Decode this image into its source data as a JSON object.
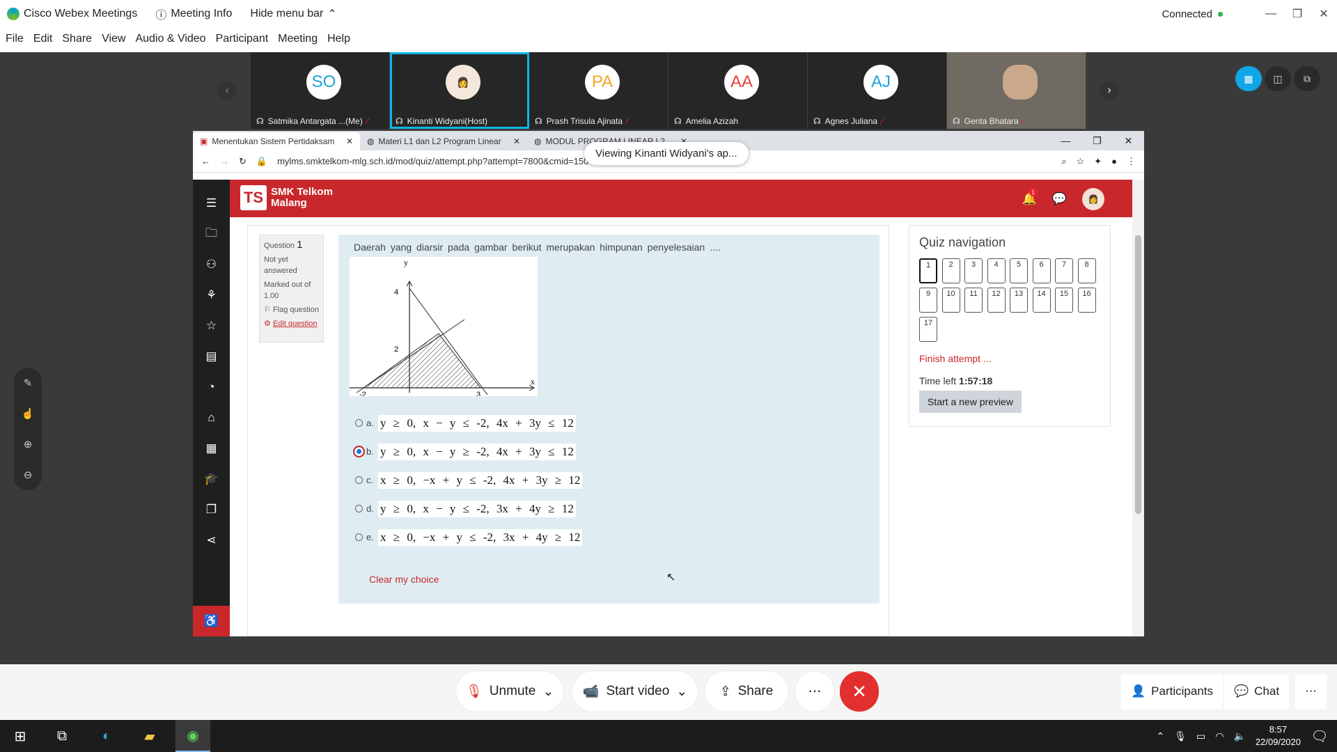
{
  "app": {
    "title": "Cisco Webex Meetings",
    "meeting_info": "Meeting Info",
    "hide_menu": "Hide menu bar",
    "status": "Connected"
  },
  "menu": [
    "File",
    "Edit",
    "Share",
    "View",
    "Audio & Video",
    "Participant",
    "Meeting",
    "Help"
  ],
  "participants": [
    {
      "initials": "SO",
      "name": "Satmika Antargata ...(Me)",
      "color": "#1aa6d8"
    },
    {
      "initials": "",
      "name": "Kinanti Widyani(Host)",
      "color": "#333"
    },
    {
      "initials": "PA",
      "name": "Prash Trisula Ajinata",
      "color": "#f5a623"
    },
    {
      "initials": "AA",
      "name": "Amelia Azizah",
      "color": "#e2453c"
    },
    {
      "initials": "AJ",
      "name": "Agnes Juliana",
      "color": "#1aa6d8"
    },
    {
      "initials": "",
      "name": "Genta Bhatara",
      "color": "#333"
    }
  ],
  "toast": "Viewing Kinanti Widyani's ap...",
  "browser": {
    "tabs": [
      "Menentukan Sistem Pertidaksam",
      "Materi L1 dan L2 Program Linear",
      "MODUL PROGRAM LINEAR L2"
    ],
    "url": "mylms.smktelkom-mlg.sch.id/mod/quiz/attempt.php?attempt=7800&cmid=150"
  },
  "site": {
    "brand_line1": "SMK Telkom",
    "brand_line2": "Malang",
    "notif_count": "1"
  },
  "question": {
    "label": "Question",
    "number": "1",
    "status": "Not yet answered",
    "marked": "Marked out of 1.00",
    "flag": "Flag question",
    "edit": "Edit question",
    "text": "Daerah yang diarsir  pada gambar  berikut  merupakan  himpunan  penyelesaian ....",
    "graph": {
      "y": "y",
      "x": "x",
      "y4": "4",
      "y2": "2",
      "xm2": "-2",
      "x3": "3"
    },
    "choices": [
      {
        "letter": "a.",
        "text": "y ≥ 0,   x − y ≤ -2,   4x + 3y ≤ 12",
        "selected": false
      },
      {
        "letter": "b.",
        "text": "y ≥ 0,   x − y ≥ -2,   4x + 3y ≤ 12",
        "selected": true
      },
      {
        "letter": "c.",
        "text": "x ≥ 0,   −x + y ≤ -2,   4x + 3y ≥ 12",
        "selected": false
      },
      {
        "letter": "d.",
        "text": "y ≥ 0,   x − y ≤ -2,   3x + 4y ≥ 12",
        "selected": false
      },
      {
        "letter": "e.",
        "text": "x ≥ 0,   −x + y ≤ -2,   3x + 4y ≥ 12",
        "selected": false
      }
    ],
    "clear": "Clear my choice"
  },
  "quiznav": {
    "title": "Quiz navigation",
    "buttons": [
      "1",
      "2",
      "3",
      "4",
      "5",
      "6",
      "7",
      "8",
      "9",
      "10",
      "11",
      "12",
      "13",
      "14",
      "15",
      "16",
      "17"
    ],
    "finish": "Finish attempt ...",
    "time_label": "Time left ",
    "time": "1:57:18",
    "preview": "Start a new preview"
  },
  "controls": {
    "unmute": "Unmute",
    "video": "Start video",
    "share": "Share",
    "participants": "Participants",
    "chat": "Chat"
  },
  "taskbar": {
    "time": "8:57",
    "date": "22/09/2020"
  }
}
